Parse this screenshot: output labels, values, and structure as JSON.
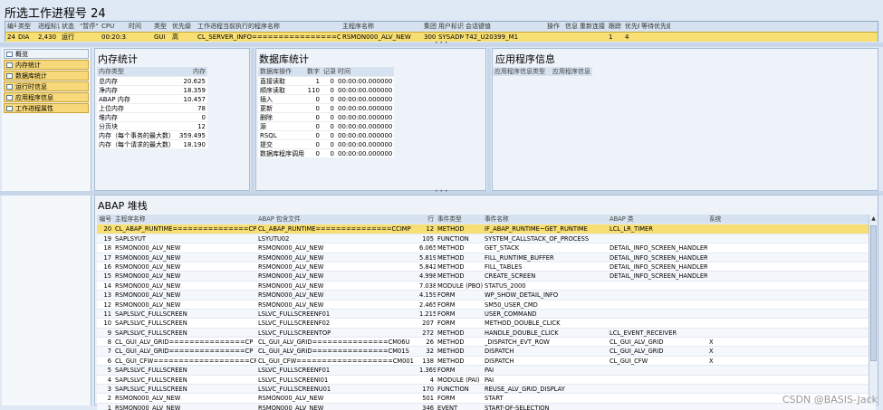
{
  "title": "所选工作进程号 24",
  "top_table": {
    "headers": [
      "编号",
      "类型",
      "进程标识",
      "状态",
      "\"暂停\"",
      "CPU",
      "时间",
      "类型",
      "优先级",
      "工作进程当前执行的程序名称",
      "主程序名称",
      "集团",
      "用户标识",
      "会话键值",
      "操作",
      "信息",
      "重新连接",
      "跟踪",
      "优先级",
      "等待优先级"
    ],
    "row": [
      "24",
      "DIA",
      "2,430",
      "运行",
      "",
      "00:20:33",
      "",
      "GUI",
      "高",
      "CL_SERVER_INFO================CP",
      "RSMON000_ALV_NEW",
      "300",
      "SYSADM",
      "T42_U20399_M1",
      "",
      "",
      "",
      "1",
      "4",
      ""
    ]
  },
  "nav": {
    "items": [
      "概览",
      "内存统计",
      "数据库统计",
      "运行时信息",
      "应用程序信息",
      "工作进程属性"
    ]
  },
  "memory": {
    "title": "内存统计",
    "headers": [
      "内存类型",
      "内存"
    ],
    "rows": [
      [
        "总内存",
        "20.625"
      ],
      [
        "净内存",
        "18.359"
      ],
      [
        "ABAP 内存",
        "10.457"
      ],
      [
        "上位内存",
        "78"
      ],
      [
        "堆内存",
        "0"
      ],
      [
        "分页块",
        "12"
      ],
      [
        "内存（每个事务的最大数）",
        "359.495"
      ],
      [
        "内存（每个请求的最大数）",
        "18.190"
      ]
    ]
  },
  "db": {
    "title": "数据库统计",
    "headers": [
      "数据库操作",
      "数字",
      "记录",
      "时间"
    ],
    "rows": [
      [
        "直接读取",
        "1",
        "0",
        "00:00:00.000000"
      ],
      [
        "顺序读取",
        "110",
        "0",
        "00:00:00.000000"
      ],
      [
        "插入",
        "0",
        "0",
        "00:00:00.000000"
      ],
      [
        "更新",
        "0",
        "0",
        "00:00:00.000000"
      ],
      [
        "删除",
        "0",
        "0",
        "00:00:00.000000"
      ],
      [
        "源",
        "0",
        "0",
        "00:00:00.000000"
      ],
      [
        "RSQL",
        "0",
        "0",
        "00:00:00.000000"
      ],
      [
        "提交",
        "0",
        "0",
        "00:00:00.000000"
      ],
      [
        "数据库程序调用",
        "0",
        "0",
        "00:00:00.000000"
      ]
    ]
  },
  "app": {
    "title": "应用程序信息",
    "headers": [
      "应用程序信息类型",
      "应用程序信息"
    ]
  },
  "abap": {
    "title": "ABAP 堆栈",
    "headers": [
      "编号",
      "主程序名称",
      "ABAP 包含文件",
      "行",
      "事件类型",
      "事件名称",
      "ABAP 类",
      "系统"
    ],
    "rows": [
      [
        "20",
        "CL_ABAP_RUNTIME===============CP",
        "CL_ABAP_RUNTIME===============CCIMP",
        "12",
        "METHOD",
        "IF_ABAP_RUNTIME~GET_RUNTIME",
        "LCL_LR_TIMER",
        ""
      ],
      [
        "19",
        "SAPLSYUT",
        "LSYUTU02",
        "105",
        "FUNCTION",
        "SYSTEM_CALLSTACK_OF_PROCESS",
        "",
        ""
      ],
      [
        "18",
        "RSMON000_ALV_NEW",
        "RSMON000_ALV_NEW",
        "6.065",
        "METHOD",
        "GET_STACK",
        "DETAIL_INFO_SCREEN_HANDLER",
        ""
      ],
      [
        "17",
        "RSMON000_ALV_NEW",
        "RSMON000_ALV_NEW",
        "5.819",
        "METHOD",
        "FILL_RUNTIME_BUFFER",
        "DETAIL_INFO_SCREEN_HANDLER",
        ""
      ],
      [
        "16",
        "RSMON000_ALV_NEW",
        "RSMON000_ALV_NEW",
        "5.842",
        "METHOD",
        "FILL_TABLES",
        "DETAIL_INFO_SCREEN_HANDLER",
        ""
      ],
      [
        "15",
        "RSMON000_ALV_NEW",
        "RSMON000_ALV_NEW",
        "4.998",
        "METHOD",
        "CREATE_SCREEN",
        "DETAIL_INFO_SCREEN_HANDLER",
        ""
      ],
      [
        "14",
        "RSMON000_ALV_NEW",
        "RSMON000_ALV_NEW",
        "7.038",
        "MODULE (PBO)",
        "STATUS_2000",
        "",
        ""
      ],
      [
        "13",
        "RSMON000_ALV_NEW",
        "RSMON000_ALV_NEW",
        "4.159",
        "FORM",
        "WP_SHOW_DETAIL_INFO",
        "",
        ""
      ],
      [
        "12",
        "RSMON000_ALV_NEW",
        "RSMON000_ALV_NEW",
        "2.465",
        "FORM",
        "SM50_USER_CMD",
        "",
        ""
      ],
      [
        "11",
        "SAPLSLVC_FULLSCREEN",
        "LSLVC_FULLSCREENF01",
        "1.215",
        "FORM",
        "USER_COMMAND",
        "",
        ""
      ],
      [
        "10",
        "SAPLSLVC_FULLSCREEN",
        "LSLVC_FULLSCREENF02",
        "207",
        "FORM",
        "METHOD_DOUBLE_CLICK",
        "",
        ""
      ],
      [
        "9",
        "SAPLSLVC_FULLSCREEN",
        "LSLVC_FULLSCREENTOP",
        "272",
        "METHOD",
        "HANDLE_DOUBLE_CLICK",
        "LCL_EVENT_RECEIVER",
        ""
      ],
      [
        "8",
        "CL_GUI_ALV_GRID===============CP",
        "CL_GUI_ALV_GRID===============CM06U",
        "26",
        "METHOD",
        "_DISPATCH_EVT_ROW",
        "CL_GUI_ALV_GRID",
        "X"
      ],
      [
        "7",
        "CL_GUI_ALV_GRID===============CP",
        "CL_GUI_ALV_GRID===============CM01S",
        "32",
        "METHOD",
        "DISPATCH",
        "CL_GUI_ALV_GRID",
        "X"
      ],
      [
        "6",
        "CL_GUI_CFW===================CP",
        "CL_GUI_CFW===================CM001",
        "138",
        "METHOD",
        "DISPATCH",
        "CL_GUI_CFW",
        "X"
      ],
      [
        "5",
        "SAPLSLVC_FULLSCREEN",
        "LSLVC_FULLSCREENF01",
        "1.369",
        "FORM",
        "PAI",
        "",
        ""
      ],
      [
        "4",
        "SAPLSLVC_FULLSCREEN",
        "LSLVC_FULLSCREENI01",
        "4",
        "MODULE (PAI)",
        "PAI",
        "",
        ""
      ],
      [
        "3",
        "SAPLSLVC_FULLSCREEN",
        "LSLVC_FULLSCREENU01",
        "170",
        "FUNCTION",
        "REUSE_ALV_GRID_DISPLAY",
        "",
        ""
      ],
      [
        "2",
        "RSMON000_ALV_NEW",
        "RSMON000_ALV_NEW",
        "501",
        "FORM",
        "START",
        "",
        ""
      ],
      [
        "1",
        "RSMON000_ALV_NEW",
        "RSMON000_ALV_NEW",
        "346",
        "EVENT",
        "START-OF-SELECTION",
        "",
        ""
      ]
    ]
  },
  "watermark": "CSDN @BASIS-Jack"
}
